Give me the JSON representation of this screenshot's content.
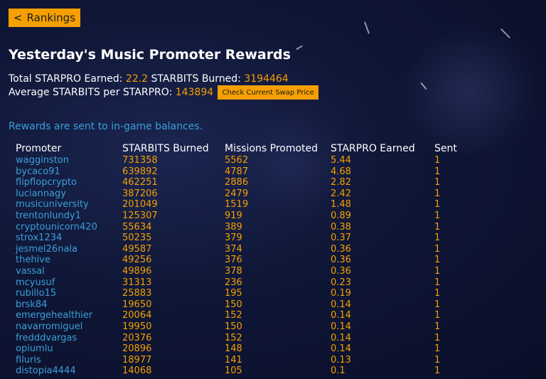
{
  "nav": {
    "back_label": "Rankings"
  },
  "title": "Yesterday's Music Promoter Rewards",
  "summary": {
    "total_label": "Total STARPRO Earned:",
    "total_value": "22.2",
    "burned_label": "STARBITS Burned:",
    "burned_value": "3194464",
    "avg_label": "Average STARBITS per STARPRO:",
    "avg_value": "143894",
    "swap_button": "Check Current Swap Price"
  },
  "note": "Rewards are sent to in-game balances.",
  "table": {
    "headers": [
      "Promoter",
      "STARBITS Burned",
      "Missions Promoted",
      "STARPRO Earned",
      "Sent"
    ],
    "rows": [
      [
        "wagginston",
        "731358",
        "5562",
        "5.44",
        "1"
      ],
      [
        "bycaco91",
        "639892",
        "4787",
        "4.68",
        "1"
      ],
      [
        "flipflopcrypto",
        "462251",
        "2886",
        "2.82",
        "1"
      ],
      [
        "luciannagy",
        "387206",
        "2479",
        "2.42",
        "1"
      ],
      [
        "musicuniversity",
        "201049",
        "1519",
        "1.48",
        "1"
      ],
      [
        "trentonlundy1",
        "125307",
        "919",
        "0.89",
        "1"
      ],
      [
        "cryptounicorn420",
        "55634",
        "389",
        "0.38",
        "1"
      ],
      [
        "strox1234",
        "50235",
        "379",
        "0.37",
        "1"
      ],
      [
        "jesmel26nala",
        "49587",
        "374",
        "0.36",
        "1"
      ],
      [
        "thehive",
        "49256",
        "376",
        "0.36",
        "1"
      ],
      [
        "vassal",
        "49896",
        "378",
        "0.36",
        "1"
      ],
      [
        "mcyusuf",
        "31313",
        "236",
        "0.23",
        "1"
      ],
      [
        "rubillo15",
        "25883",
        "195",
        "0.19",
        "1"
      ],
      [
        "brsk84",
        "19650",
        "150",
        "0.14",
        "1"
      ],
      [
        "emergehealthier",
        "20064",
        "152",
        "0.14",
        "1"
      ],
      [
        "navarromiguel",
        "19950",
        "150",
        "0.14",
        "1"
      ],
      [
        "fredddvargas",
        "20376",
        "152",
        "0.14",
        "1"
      ],
      [
        "opiumlu",
        "20896",
        "148",
        "0.14",
        "1"
      ],
      [
        "filuris",
        "18977",
        "141",
        "0.13",
        "1"
      ],
      [
        "distopia4444",
        "14068",
        "105",
        "0.1",
        "1"
      ]
    ]
  }
}
